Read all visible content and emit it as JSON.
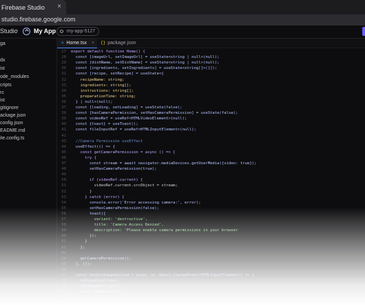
{
  "browser": {
    "tab_title": "Firebase Studio",
    "close_label": "×",
    "url": "studio.firebase.google.com"
  },
  "appbar": {
    "studio_label": "Studio",
    "separator": "›",
    "app_name": "My App",
    "workspace_chip": "my-app-5127"
  },
  "sidebar": {
    "items": [
      {
        "label": "ga"
      },
      {
        "label": "dx"
      },
      {
        "label": "ist"
      },
      {
        "label": "ode_modules"
      },
      {
        "label": "cripts"
      },
      {
        "label": "rc"
      },
      {
        "label": "ist"
      },
      {
        "label": "gitignore"
      },
      {
        "label": "ackage.json"
      },
      {
        "label": "config.json"
      },
      {
        "label": "EADME.md"
      },
      {
        "label": "ite.config.ts"
      }
    ]
  },
  "editor": {
    "tabs": [
      {
        "icon": "ts",
        "label": "Home.tsx",
        "close": "×"
      },
      {
        "icon": "{}",
        "label": "package.json"
      }
    ],
    "code": [
      {
        "n": "27",
        "text": "export default function Home() {",
        "c": "#c4a7ff"
      },
      {
        "n": "28",
        "text": "  const [imageUrl, setImageUrl] = useState<string | null>(null);",
        "c": "#b7c4ff"
      },
      {
        "n": "29",
        "text": "  const [dishName, setDishName] = useState<string | null>(null);",
        "c": "#b7c4ff"
      },
      {
        "n": "30",
        "text": "  const [ingredients, setIngredients] = useState<string[]>([]);",
        "c": "#b7c4ff"
      },
      {
        "n": "31",
        "text": "  const [recipe, setRecipe] = useState<{",
        "c": "#b7c4ff"
      },
      {
        "n": "32",
        "text": "    recipeName: string;",
        "c": "#f3d58a"
      },
      {
        "n": "33",
        "text": "    ingredients: string[];",
        "c": "#f3d58a"
      },
      {
        "n": "34",
        "text": "    instructions: string[];",
        "c": "#f3d58a"
      },
      {
        "n": "35",
        "text": "    preparationTime: string;",
        "c": "#f3d58a"
      },
      {
        "n": "36",
        "text": "  } | null>(null);",
        "c": "#b7c4ff"
      },
      {
        "n": "37",
        "text": "  const [loading, setLoading] = useState(false);",
        "c": "#b7c4ff"
      },
      {
        "n": "38",
        "text": "  const [hasCameraPermission, setHasCameraPermission] = useState(false);",
        "c": "#b7c4ff"
      },
      {
        "n": "39",
        "text": "  const videoRef = useRef<HTMLVideoElement>(null);",
        "c": "#b7c4ff"
      },
      {
        "n": "40",
        "text": "  const {toast} = useToast();",
        "c": "#b7c4ff"
      },
      {
        "n": "41",
        "text": "  const fileInputRef = useRef<HTMLInputElement>(null);",
        "c": "#b7c4ff"
      },
      {
        "n": "42",
        "text": "",
        "c": "#d4d4d8"
      },
      {
        "n": "43",
        "text": "  //Camera Permission useEffect",
        "c": "#6b8cc7"
      },
      {
        "n": "44",
        "text": "  useEffect(() => {",
        "c": "#b7c4ff"
      },
      {
        "n": "45",
        "text": "    const getCameraPermission = async () => {",
        "c": "#c4a7ff"
      },
      {
        "n": "46",
        "text": "      try {",
        "c": "#c4a7ff"
      },
      {
        "n": "47",
        "text": "        const stream = await navigator.mediaDevices.getUserMedia({video: true});",
        "c": "#b7c4ff"
      },
      {
        "n": "48",
        "text": "        setHasCameraPermission(true);",
        "c": "#b7c4ff"
      },
      {
        "n": "49",
        "text": "",
        "c": "#d4d4d8"
      },
      {
        "n": "50",
        "text": "        if (videoRef.current) {",
        "c": "#c4a7ff"
      },
      {
        "n": "51",
        "text": "          videoRef.current.srcObject = stream;",
        "c": "#d4d4d8"
      },
      {
        "n": "52",
        "text": "        }",
        "c": "#d4d4d8"
      },
      {
        "n": "53",
        "text": "      } catch (error) {",
        "c": "#c4a7ff"
      },
      {
        "n": "54",
        "text": "        console.error('Error accessing camera:', error);",
        "c": "#b7c4ff"
      },
      {
        "n": "55",
        "text": "        setHasCameraPermission(false);",
        "c": "#b7c4ff"
      },
      {
        "n": "56",
        "text": "        toast({",
        "c": "#b7c4ff"
      },
      {
        "n": "57",
        "text": "          variant: 'destructive',",
        "c": "#9fd89a"
      },
      {
        "n": "58",
        "text": "          title: 'Camera Access Denied',",
        "c": "#9fd89a"
      },
      {
        "n": "59",
        "text": "          description: 'Please enable camera permissions in your browser",
        "c": "#9fd89a"
      },
      {
        "n": "60",
        "text": "        });",
        "c": "#d4d4d8"
      },
      {
        "n": "61",
        "text": "      }",
        "c": "#d4d4d8"
      },
      {
        "n": "62",
        "text": "    };",
        "c": "#d4d4d8"
      },
      {
        "n": "63",
        "text": "",
        "c": "#d4d4d8"
      },
      {
        "n": "64",
        "text": "    getCameraPermission();",
        "c": "#b7c4ff"
      },
      {
        "n": "65",
        "text": "  }, []);",
        "c": "#d4d4d8"
      },
      {
        "n": "66",
        "text": "",
        "c": "#d4d4d8"
      },
      {
        "n": "67",
        "text": "  const handleImageUpload = async (e: React.ChangeEvent<HTMLInputElement>) => {",
        "c": "#b7c4ff"
      },
      {
        "n": "68",
        "text": "    setLoading(true);",
        "c": "#b7c4ff"
      },
      {
        "n": "69",
        "text": "    setImageUrl(null);",
        "c": "#b7c4ff"
      },
      {
        "n": "70",
        "text": "    setDishName(null);",
        "c": "#b7c4ff"
      }
    ]
  }
}
